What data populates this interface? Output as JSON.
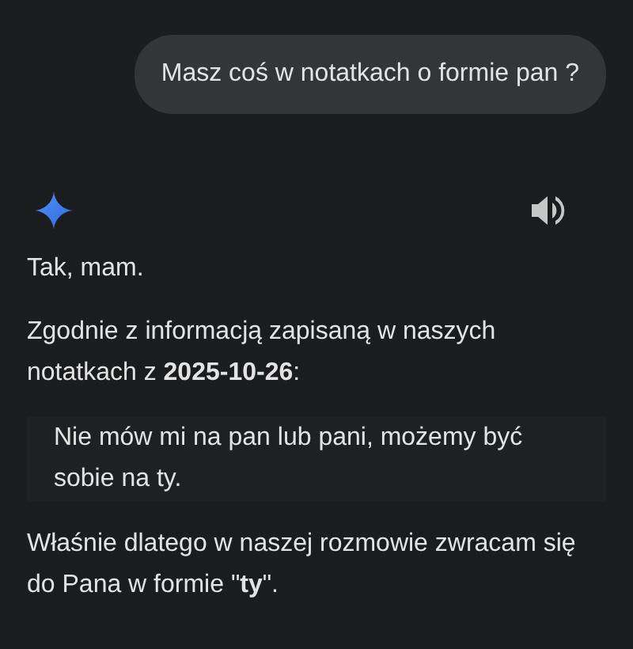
{
  "user_message": "Masz coś w notatkach o formie pan ?",
  "response": {
    "paragraphs": [
      {
        "kind": "text",
        "text": "Tak, mam."
      },
      {
        "kind": "text",
        "text": "Zgodnie z informacją zapisaną w naszych notatkach z **2025-10-26**:"
      },
      {
        "kind": "quote",
        "text": "Nie mów mi na pan lub pani, możemy być sobie na ty."
      },
      {
        "kind": "text",
        "text": "Właśnie dlatego w naszej rozmowie zwracam się do Pana w formie \"**ty**\"."
      }
    ]
  }
}
